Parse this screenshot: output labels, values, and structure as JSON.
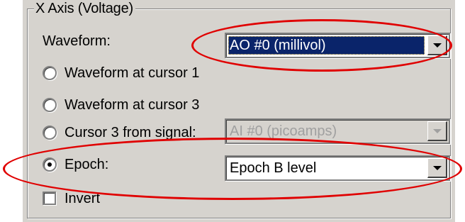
{
  "group": {
    "title": "X Axis (Voltage)"
  },
  "waveform": {
    "label": "Waveform:",
    "selected_value": "AO #0 (millivol)"
  },
  "options": {
    "cursor1_label": "Waveform at cursor 1",
    "cursor3_label": "Waveform at cursor 3",
    "cursor3_from_signal_label": "Cursor 3 from signal:",
    "cursor3_from_signal_value": "AI #0 (picoamps)",
    "epoch_label": "Epoch:",
    "epoch_value": "Epoch B level",
    "selected": "Epoch"
  },
  "invert": {
    "label": "Invert",
    "checked": false
  },
  "colors": {
    "panel_bg": "#d6d3ce",
    "selection_bg": "#0a246a",
    "highlight_ellipse": "#e00000"
  },
  "icons": {
    "dropdown": "chevron-down-icon",
    "radio": "radio-button",
    "checkbox": "checkbox"
  }
}
